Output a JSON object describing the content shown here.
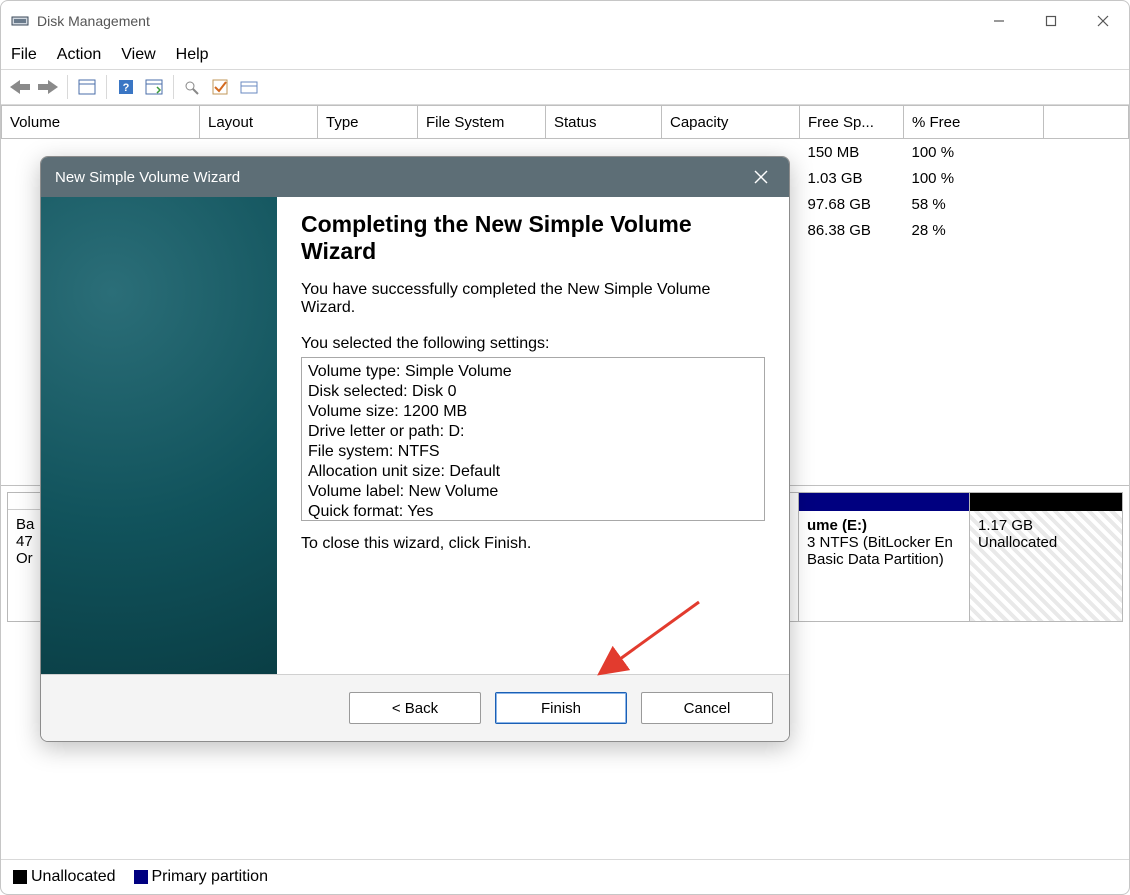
{
  "window": {
    "title": "Disk Management"
  },
  "menu": {
    "file": "File",
    "action": "Action",
    "view": "View",
    "help": "Help"
  },
  "columns": {
    "volume": "Volume",
    "layout": "Layout",
    "type": "Type",
    "file_system": "File System",
    "status": "Status",
    "capacity": "Capacity",
    "free_space": "Free Sp...",
    "pct_free": "% Free"
  },
  "rows": [
    {
      "free": "150 MB",
      "pct": "100 %"
    },
    {
      "free": "1.03 GB",
      "pct": "100 %"
    },
    {
      "free": "97.68 GB",
      "pct": "58 %"
    },
    {
      "free": "86.38 GB",
      "pct": "28 %"
    }
  ],
  "disk": {
    "label_line1": "Ba",
    "label_line2": "47",
    "label_line3": "Or",
    "part_e_line1": "ume  (E:)",
    "part_e_line2": "3 NTFS (BitLocker En",
    "part_e_line3": "Basic Data Partition)",
    "unalloc_line1": "1.17 GB",
    "unalloc_line2": "Unallocated"
  },
  "legend": {
    "unallocated": "Unallocated",
    "primary": "Primary partition"
  },
  "wizard": {
    "title": "New Simple Volume Wizard",
    "heading": "Completing the New Simple Volume Wizard",
    "success": "You have successfully completed the New Simple Volume Wizard.",
    "selected_label": "You selected the following settings:",
    "close_hint": "To close this wizard, click Finish.",
    "settings": [
      "Volume type: Simple Volume",
      "Disk selected: Disk 0",
      "Volume size: 1200 MB",
      "Drive letter or path: D:",
      "File system: NTFS",
      "Allocation unit size: Default",
      "Volume label: New Volume",
      "Quick format: Yes"
    ],
    "buttons": {
      "back": "< Back",
      "finish": "Finish",
      "cancel": "Cancel"
    }
  }
}
